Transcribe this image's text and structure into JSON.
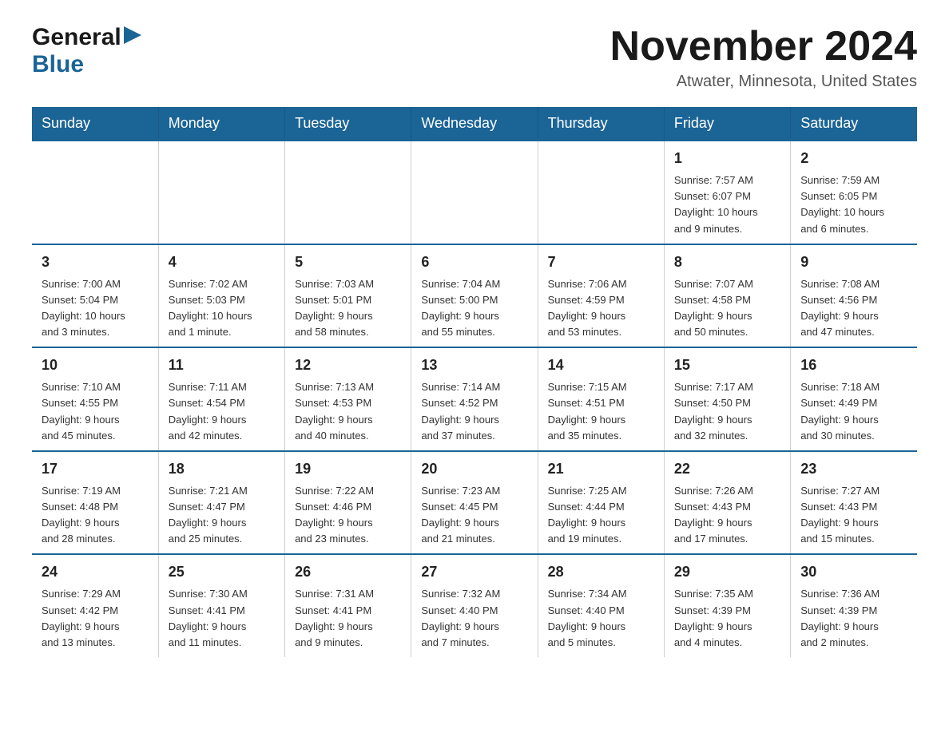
{
  "header": {
    "logo_general": "General",
    "logo_blue": "Blue",
    "month_title": "November 2024",
    "location": "Atwater, Minnesota, United States"
  },
  "calendar": {
    "weekdays": [
      "Sunday",
      "Monday",
      "Tuesday",
      "Wednesday",
      "Thursday",
      "Friday",
      "Saturday"
    ],
    "weeks": [
      [
        {
          "day": "",
          "info": ""
        },
        {
          "day": "",
          "info": ""
        },
        {
          "day": "",
          "info": ""
        },
        {
          "day": "",
          "info": ""
        },
        {
          "day": "",
          "info": ""
        },
        {
          "day": "1",
          "info": "Sunrise: 7:57 AM\nSunset: 6:07 PM\nDaylight: 10 hours\nand 9 minutes."
        },
        {
          "day": "2",
          "info": "Sunrise: 7:59 AM\nSunset: 6:05 PM\nDaylight: 10 hours\nand 6 minutes."
        }
      ],
      [
        {
          "day": "3",
          "info": "Sunrise: 7:00 AM\nSunset: 5:04 PM\nDaylight: 10 hours\nand 3 minutes."
        },
        {
          "day": "4",
          "info": "Sunrise: 7:02 AM\nSunset: 5:03 PM\nDaylight: 10 hours\nand 1 minute."
        },
        {
          "day": "5",
          "info": "Sunrise: 7:03 AM\nSunset: 5:01 PM\nDaylight: 9 hours\nand 58 minutes."
        },
        {
          "day": "6",
          "info": "Sunrise: 7:04 AM\nSunset: 5:00 PM\nDaylight: 9 hours\nand 55 minutes."
        },
        {
          "day": "7",
          "info": "Sunrise: 7:06 AM\nSunset: 4:59 PM\nDaylight: 9 hours\nand 53 minutes."
        },
        {
          "day": "8",
          "info": "Sunrise: 7:07 AM\nSunset: 4:58 PM\nDaylight: 9 hours\nand 50 minutes."
        },
        {
          "day": "9",
          "info": "Sunrise: 7:08 AM\nSunset: 4:56 PM\nDaylight: 9 hours\nand 47 minutes."
        }
      ],
      [
        {
          "day": "10",
          "info": "Sunrise: 7:10 AM\nSunset: 4:55 PM\nDaylight: 9 hours\nand 45 minutes."
        },
        {
          "day": "11",
          "info": "Sunrise: 7:11 AM\nSunset: 4:54 PM\nDaylight: 9 hours\nand 42 minutes."
        },
        {
          "day": "12",
          "info": "Sunrise: 7:13 AM\nSunset: 4:53 PM\nDaylight: 9 hours\nand 40 minutes."
        },
        {
          "day": "13",
          "info": "Sunrise: 7:14 AM\nSunset: 4:52 PM\nDaylight: 9 hours\nand 37 minutes."
        },
        {
          "day": "14",
          "info": "Sunrise: 7:15 AM\nSunset: 4:51 PM\nDaylight: 9 hours\nand 35 minutes."
        },
        {
          "day": "15",
          "info": "Sunrise: 7:17 AM\nSunset: 4:50 PM\nDaylight: 9 hours\nand 32 minutes."
        },
        {
          "day": "16",
          "info": "Sunrise: 7:18 AM\nSunset: 4:49 PM\nDaylight: 9 hours\nand 30 minutes."
        }
      ],
      [
        {
          "day": "17",
          "info": "Sunrise: 7:19 AM\nSunset: 4:48 PM\nDaylight: 9 hours\nand 28 minutes."
        },
        {
          "day": "18",
          "info": "Sunrise: 7:21 AM\nSunset: 4:47 PM\nDaylight: 9 hours\nand 25 minutes."
        },
        {
          "day": "19",
          "info": "Sunrise: 7:22 AM\nSunset: 4:46 PM\nDaylight: 9 hours\nand 23 minutes."
        },
        {
          "day": "20",
          "info": "Sunrise: 7:23 AM\nSunset: 4:45 PM\nDaylight: 9 hours\nand 21 minutes."
        },
        {
          "day": "21",
          "info": "Sunrise: 7:25 AM\nSunset: 4:44 PM\nDaylight: 9 hours\nand 19 minutes."
        },
        {
          "day": "22",
          "info": "Sunrise: 7:26 AM\nSunset: 4:43 PM\nDaylight: 9 hours\nand 17 minutes."
        },
        {
          "day": "23",
          "info": "Sunrise: 7:27 AM\nSunset: 4:43 PM\nDaylight: 9 hours\nand 15 minutes."
        }
      ],
      [
        {
          "day": "24",
          "info": "Sunrise: 7:29 AM\nSunset: 4:42 PM\nDaylight: 9 hours\nand 13 minutes."
        },
        {
          "day": "25",
          "info": "Sunrise: 7:30 AM\nSunset: 4:41 PM\nDaylight: 9 hours\nand 11 minutes."
        },
        {
          "day": "26",
          "info": "Sunrise: 7:31 AM\nSunset: 4:41 PM\nDaylight: 9 hours\nand 9 minutes."
        },
        {
          "day": "27",
          "info": "Sunrise: 7:32 AM\nSunset: 4:40 PM\nDaylight: 9 hours\nand 7 minutes."
        },
        {
          "day": "28",
          "info": "Sunrise: 7:34 AM\nSunset: 4:40 PM\nDaylight: 9 hours\nand 5 minutes."
        },
        {
          "day": "29",
          "info": "Sunrise: 7:35 AM\nSunset: 4:39 PM\nDaylight: 9 hours\nand 4 minutes."
        },
        {
          "day": "30",
          "info": "Sunrise: 7:36 AM\nSunset: 4:39 PM\nDaylight: 9 hours\nand 2 minutes."
        }
      ]
    ]
  }
}
